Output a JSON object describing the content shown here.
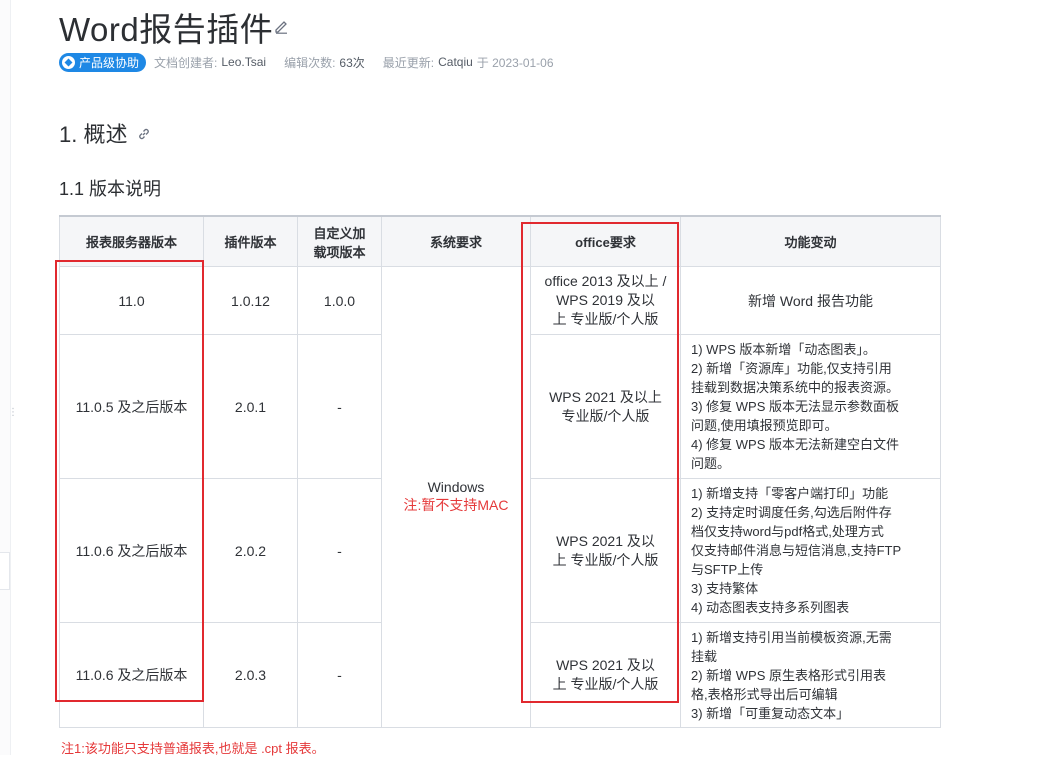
{
  "page": {
    "title": "Word报告插件",
    "badge": "产品级协助",
    "meta": {
      "creator_label": "文档创建者:",
      "creator": "Leo.Tsai",
      "edits_label": "编辑次数:",
      "edits": "63次",
      "updated_label": "最近更新:",
      "updated_by": "Catqiu",
      "updated_on": "于 2023-01-06"
    },
    "h1": "1. 概述",
    "h2": "1.1 版本说明",
    "footnote": "注1:该功能只支持普通报表,也就是 .cpt 报表。"
  },
  "table": {
    "headers": {
      "server": "报表服务器版本",
      "plugin": "插件版本",
      "custom_1": "自定义加",
      "custom_2": "载项版本",
      "system": "系统要求",
      "office": "office要求",
      "func": "功能变动"
    },
    "system": {
      "os": "Windows",
      "note": "注:暂不支持MAC"
    },
    "rows": [
      {
        "server": "11.0",
        "plugin": "1.0.12",
        "custom": "1.0.0",
        "office": [
          "office 2013 及以上 /",
          "WPS 2019 及以",
          "上 专业版/个人版"
        ],
        "func": [
          "新增 Word 报告功能"
        ]
      },
      {
        "server": "11.0.5 及之后版本",
        "plugin": "2.0.1",
        "custom": "-",
        "office": [
          "WPS 2021 及以上",
          "专业版/个人版"
        ],
        "func": [
          "1) WPS 版本新增「动态图表」。",
          "2) 新增「资源库」功能,仅支持引用",
          "挂载到数据决策系统中的报表资源。",
          "3) 修复 WPS 版本无法显示参数面板",
          "问题,使用填报预览即可。",
          "4) 修复 WPS 版本无法新建空白文件",
          "问题。"
        ]
      },
      {
        "server": "11.0.6 及之后版本",
        "plugin": "2.0.2",
        "custom": "-",
        "office": [
          "WPS 2021 及以",
          "上 专业版/个人版"
        ],
        "func": [
          "1) 新增支持「零客户端打印」功能",
          "2) 支持定时调度任务,勾选后附件存",
          "档仅支持word与pdf格式,处理方式",
          "仅支持邮件消息与短信消息,支持FTP",
          "与SFTP上传",
          "3) 支持繁体",
          "4) 动态图表支持多系列图表"
        ]
      },
      {
        "server": "11.0.6 及之后版本",
        "plugin": "2.0.3",
        "custom": "-",
        "office": [
          "WPS 2021 及以",
          "上 专业版/个人版"
        ],
        "func": [
          "1) 新增支持引用当前模板资源,无需",
          "挂载",
          "2) 新增 WPS 原生表格形式引用表",
          "格,表格形式导出后可编辑",
          "3) 新增「可重复动态文本」"
        ]
      }
    ]
  },
  "colors": {
    "accent": "#1e88e5",
    "highlight_box": "#e1292f",
    "note": "#e5393a"
  }
}
